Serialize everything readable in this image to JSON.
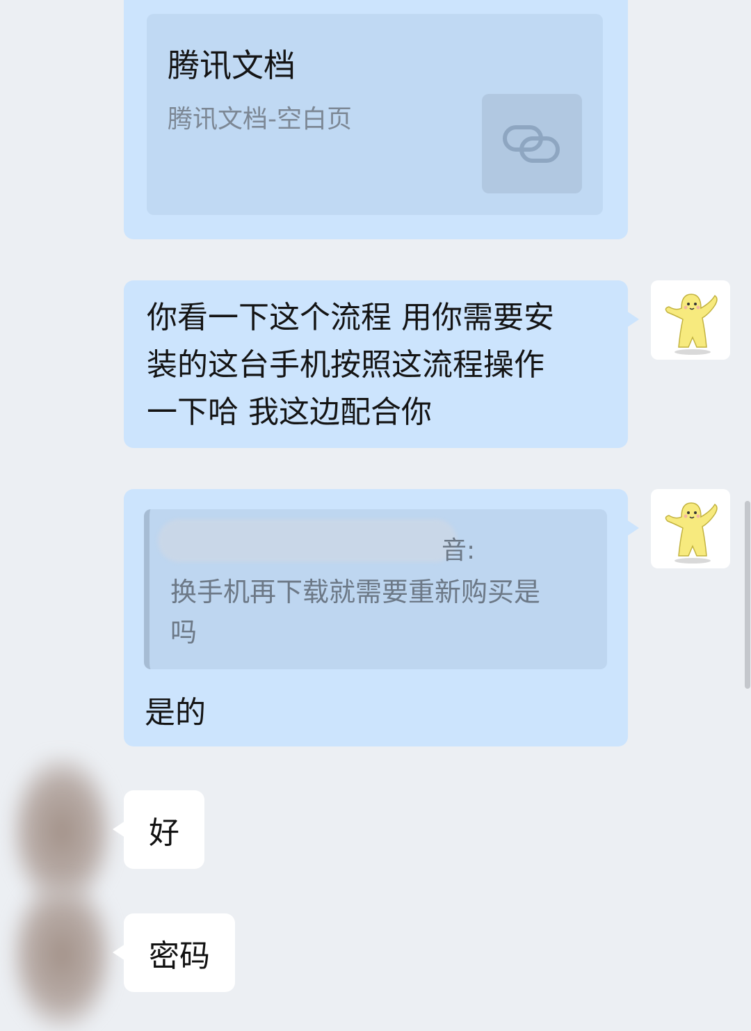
{
  "messages": {
    "card": {
      "title": "腾讯文档",
      "description": "腾讯文档-空白页",
      "thumb_icon": "link-icon"
    },
    "instruction": {
      "line1": "你看一下这个流程  用你需要安",
      "line2": "装的这台手机按照这流程操作",
      "line3": "一下哈 我这边配合你"
    },
    "quoted_reply": {
      "quote_sender_suffix": "音:",
      "quote_line1": "换手机再下载就需要重新购买是",
      "quote_line2": "吗",
      "reply": "是的"
    },
    "incoming_1": "好",
    "incoming_2": "密码"
  },
  "colors": {
    "background": "#eceff3",
    "outgoing_bubble": "#cce4fd",
    "incoming_bubble": "#ffffff"
  }
}
